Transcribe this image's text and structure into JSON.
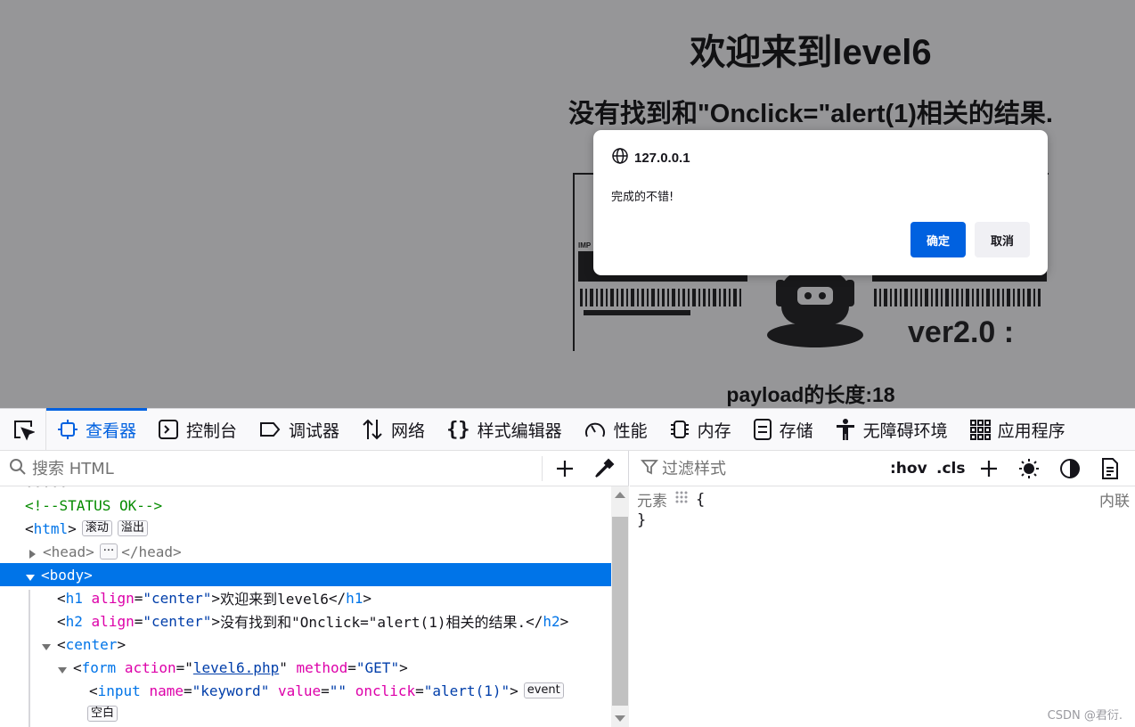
{
  "page": {
    "heading": "欢迎来到level6",
    "subheading": "没有找到和\"Onclick=\"alert(1)相关的结果.",
    "banner_text": "ver2.0 :",
    "payload_label": "payload的长度:18"
  },
  "dialog": {
    "origin": "127.0.0.1",
    "message": "完成的不错!",
    "ok_label": "确定",
    "cancel_label": "取消"
  },
  "devtools": {
    "tabs": [
      {
        "label": "查看器",
        "icon": "inspector-icon",
        "active": true
      },
      {
        "label": "控制台",
        "icon": "console-icon"
      },
      {
        "label": "调试器",
        "icon": "debugger-icon"
      },
      {
        "label": "网络",
        "icon": "network-icon"
      },
      {
        "label": "样式编辑器",
        "icon": "style-editor-icon"
      },
      {
        "label": "性能",
        "icon": "performance-icon"
      },
      {
        "label": "内存",
        "icon": "memory-icon"
      },
      {
        "label": "存储",
        "icon": "storage-icon"
      },
      {
        "label": "无障碍环境",
        "icon": "accessibility-icon"
      },
      {
        "label": "应用程序",
        "icon": "application-icon"
      }
    ],
    "search_placeholder": "搜索 HTML",
    "tree": {
      "comment": "<!--STATUS OK-->",
      "html_badges": [
        "滚动",
        "溢出"
      ],
      "head_badge": "···",
      "h1_text": "欢迎来到level6",
      "h2_text": "没有找到和\"Onclick=\"alert(1)相关的结果.",
      "align_value": "\"center\"",
      "form_action": "level6.php",
      "form_method": "\"GET\"",
      "input_name": "\"keyword\"",
      "input_value": "\"\"",
      "input_onclick": "\"alert(1)\"",
      "event_badge": "event",
      "whitespace_badge": "空白"
    },
    "rules": {
      "filter_placeholder": "过滤样式",
      "hov_label": ":hov",
      "cls_label": ".cls",
      "element_label": "元素",
      "open_brace": "{",
      "close_brace": "}",
      "source_label": "内联"
    },
    "watermark": "CSDN @君衍."
  },
  "colors": {
    "accent": "#0061e0",
    "selection": "#0074e8",
    "tag": "#0074e8",
    "attr_name": "#dd00a9",
    "attr_value": "#003eaa",
    "comment": "#058b00"
  }
}
